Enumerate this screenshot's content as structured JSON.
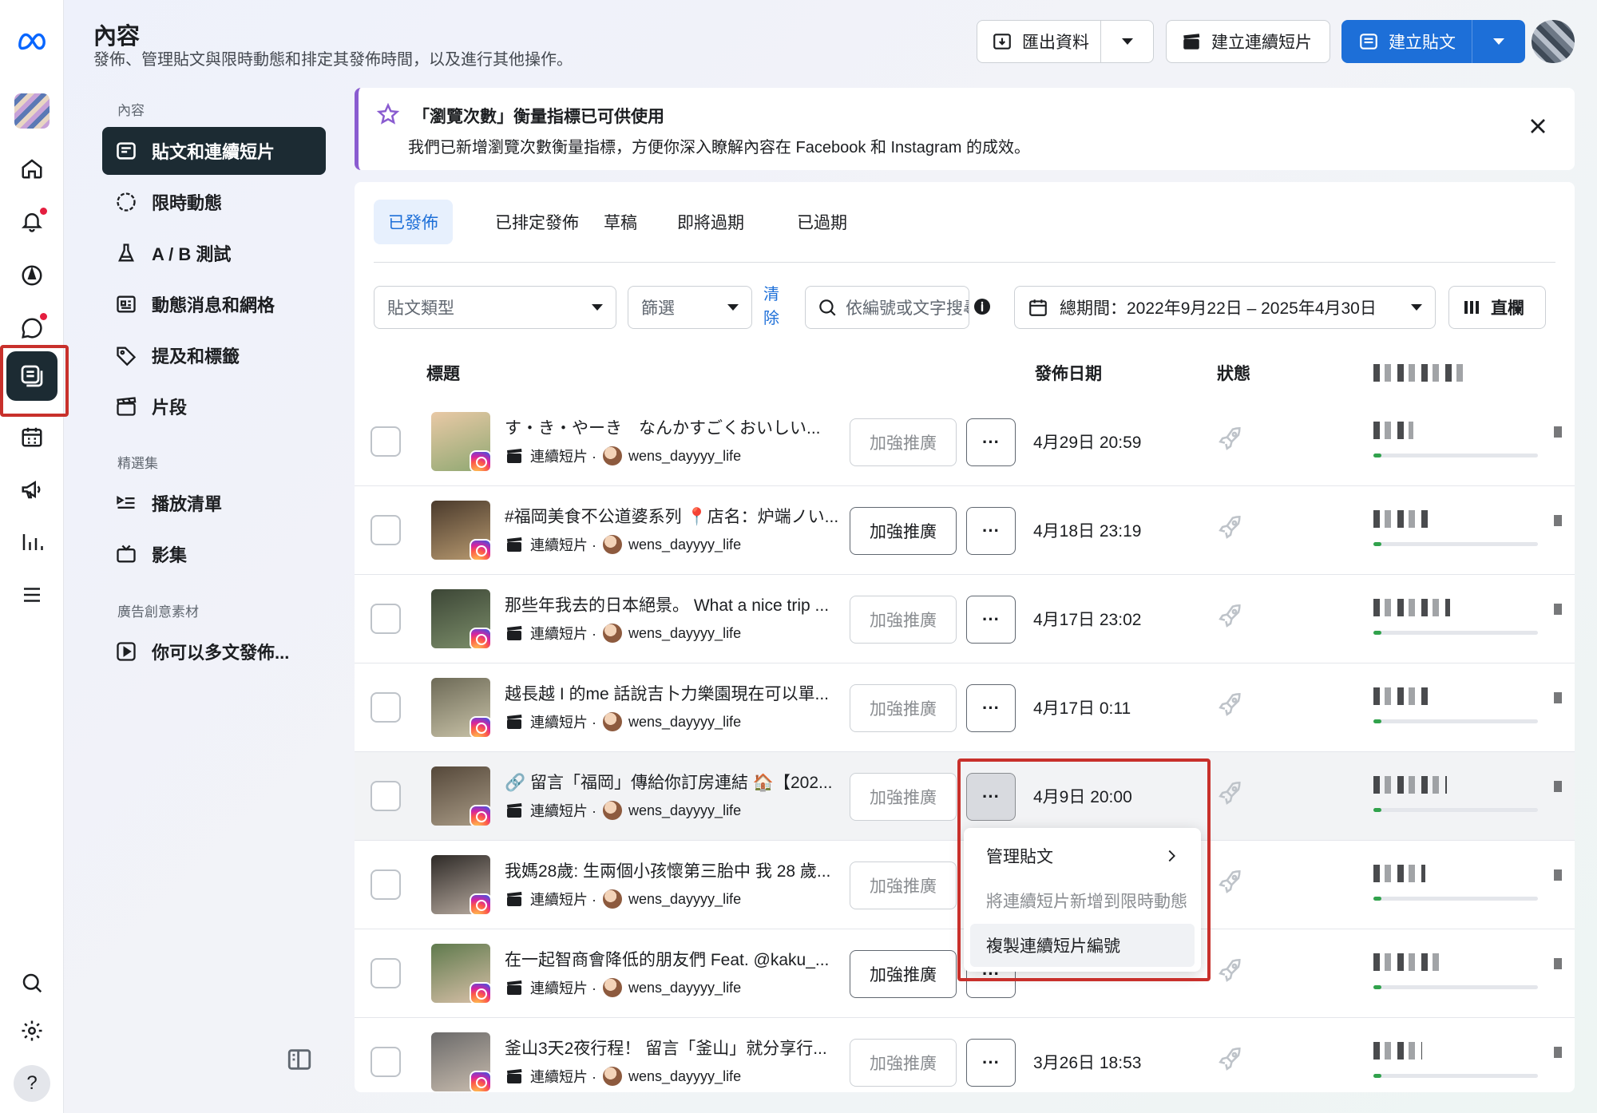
{
  "header": {
    "title": "內容",
    "subtitle": "發佈、管理貼文與限時動態和排定其發佈時間，以及進行其他操作。",
    "export_label": "匯出資料",
    "create_reel_label": "建立連續短片",
    "create_post_label": "建立貼文"
  },
  "nav": {
    "section_content": "內容",
    "section_featured": "精選集",
    "section_ads": "廣告創意素材",
    "items": [
      {
        "label": "貼文和連續短片"
      },
      {
        "label": "限時動態"
      },
      {
        "label": "A / B 測試"
      },
      {
        "label": "動態消息和網格"
      },
      {
        "label": "提及和標籤"
      },
      {
        "label": "片段"
      },
      {
        "label": "播放清單"
      },
      {
        "label": "影集"
      },
      {
        "label": "你可以多文發佈..."
      }
    ]
  },
  "banner": {
    "title": "「瀏覽次數」衡量指標已可供使用",
    "body": "我們已新增瀏覽次數衡量指標，方便你深入瞭解內容在 Facebook 和 Instagram 的成效。"
  },
  "tabs": [
    {
      "label": "已發佈"
    },
    {
      "label": "已排定發佈"
    },
    {
      "label": "草稿"
    },
    {
      "label": "即將過期"
    },
    {
      "label": "已過期"
    }
  ],
  "filters": {
    "post_type_placeholder": "貼文類型",
    "filter_placeholder": "篩選",
    "clear_label": "清除",
    "search_placeholder": "依編號或文字搜尋",
    "date_range": "總期間：2022年9月22日 – 2025年4月30日",
    "columns_label": "直欄"
  },
  "columns": {
    "title": "標題",
    "date": "發佈日期",
    "status": "狀態"
  },
  "rows": [
    {
      "title": "す・き・やーき　なんかすごくおいしい...",
      "type": "連續短片 ·",
      "account": "wens_dayyyy_life",
      "boost": "加強推廣",
      "date": "4月29日 20:59"
    },
    {
      "title": "#福岡美食不公道婆系列 📍店名：炉端ノい...",
      "type": "連續短片 ·",
      "account": "wens_dayyyy_life",
      "boost": "加強推廣",
      "date": "4月18日 23:19"
    },
    {
      "title": "那些年我去的日本絕景。 What a nice trip ...",
      "type": "連續短片 ·",
      "account": "wens_dayyyy_life",
      "boost": "加強推廣",
      "date": "4月17日 23:02"
    },
    {
      "title": "越長越 I 的me 話說吉卜力樂園現在可以單...",
      "type": "連續短片 ·",
      "account": "wens_dayyyy_life",
      "boost": "加強推廣",
      "date": "4月17日 0:11"
    },
    {
      "title": "🔗 留言「福岡」傳給你訂房連結 🏠【202...",
      "type": "連續短片 ·",
      "account": "wens_dayyyy_life",
      "boost": "加強推廣",
      "date": "4月9日 20:00"
    },
    {
      "title": "我媽28歲: 生兩個小孩懷第三胎中 我 28 歲...",
      "type": "連續短片 ·",
      "account": "wens_dayyyy_life",
      "boost": "加強推廣",
      "date": ""
    },
    {
      "title": "在一起智商會降低的朋友們 Feat. @kaku_...",
      "type": "連續短片 ·",
      "account": "wens_dayyyy_life",
      "boost": "加強推廣",
      "date": ""
    },
    {
      "title": "釜山3天2夜行程！ 留言「釜山」就分享行...",
      "type": "連續短片 ·",
      "account": "wens_dayyyy_life",
      "boost": "加強推廣",
      "date": "3月26日 18:53"
    }
  ],
  "menu": {
    "manage_post": "管理貼文",
    "add_to_story": "將連續短片新增到限時動態",
    "copy_reel_id": "複製連續短片編號"
  },
  "colors": {
    "primary": "#1d6fd8",
    "nav_active": "#1c2b33",
    "highlight_box": "#c8302b",
    "banner_accent": "#8a5cd0"
  }
}
